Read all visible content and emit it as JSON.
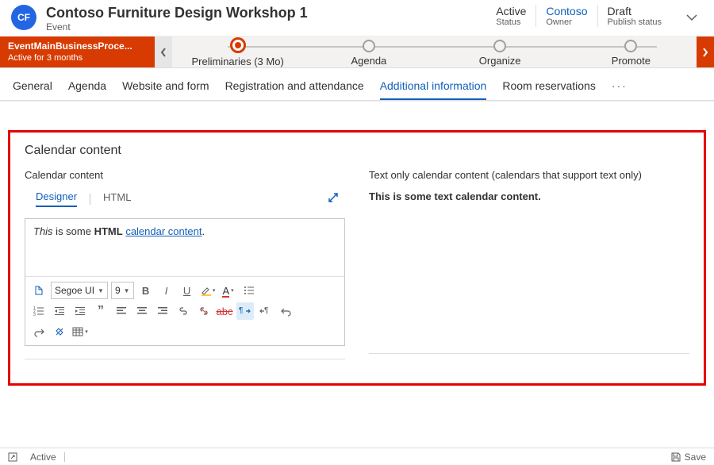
{
  "header": {
    "avatar_initials": "CF",
    "title": "Contoso Furniture Design Workshop 1",
    "entity": "Event",
    "status": {
      "value": "Active",
      "label": "Status"
    },
    "owner": {
      "value": "Contoso",
      "label": "Owner"
    },
    "publish": {
      "value": "Draft",
      "label": "Publish status"
    }
  },
  "bpf": {
    "name": "EventMainBusinessProce...",
    "duration": "Active for 3 months",
    "stages": [
      {
        "label": "Preliminaries  (3 Mo)",
        "active": true
      },
      {
        "label": "Agenda",
        "active": false
      },
      {
        "label": "Organize",
        "active": false
      },
      {
        "label": "Promote",
        "active": false
      }
    ]
  },
  "tabs": [
    "General",
    "Agenda",
    "Website and form",
    "Registration and attendance",
    "Additional information",
    "Room reservations"
  ],
  "active_tab": "Additional information",
  "section": {
    "title": "Calendar content",
    "left": {
      "label": "Calendar content",
      "designer_tabs": {
        "designer": "Designer",
        "html": "HTML"
      },
      "html_content_prefix_italic": "This",
      "html_content_mid": " is some ",
      "html_content_bold": "HTML",
      "html_content_space": " ",
      "html_content_link": "calendar content",
      "html_content_suffix": ".",
      "font_name": "Segoe UI",
      "font_size": "9"
    },
    "right": {
      "label": "Text only calendar content (calendars that support text only)",
      "value": "This is some text calendar content."
    }
  },
  "footer": {
    "status": "Active",
    "save": "Save"
  }
}
